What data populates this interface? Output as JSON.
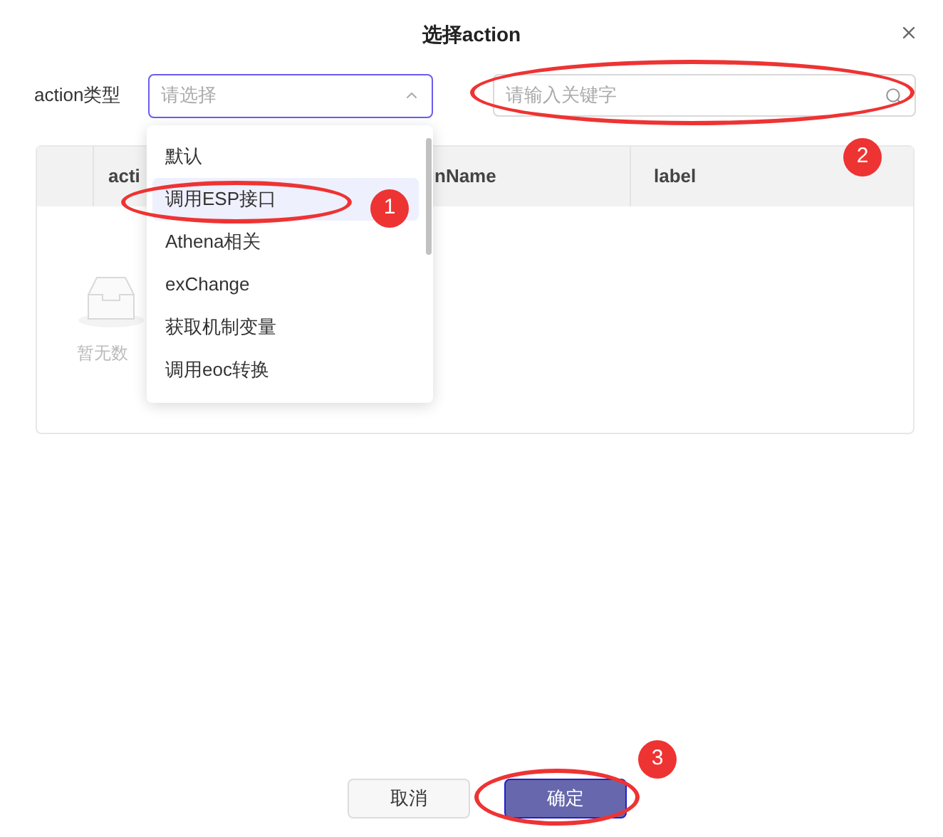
{
  "dialog": {
    "title": "选择action",
    "filter_label": "action类型",
    "select": {
      "placeholder": "请选择",
      "expanded": true
    },
    "search": {
      "placeholder": "请输入关键字"
    }
  },
  "table": {
    "columns": [
      "acti",
      "nName",
      "label"
    ],
    "empty_text": "暂无数"
  },
  "dropdown": {
    "options": [
      {
        "label": "默认",
        "selected": false
      },
      {
        "label": "调用ESP接口",
        "selected": true
      },
      {
        "label": "Athena相关",
        "selected": false
      },
      {
        "label": "exChange",
        "selected": false
      },
      {
        "label": "获取机制变量",
        "selected": false
      },
      {
        "label": "调用eoc转换",
        "selected": false
      }
    ]
  },
  "buttons": {
    "cancel": "取消",
    "confirm": "确定"
  },
  "annotations": [
    "1",
    "2",
    "3"
  ]
}
